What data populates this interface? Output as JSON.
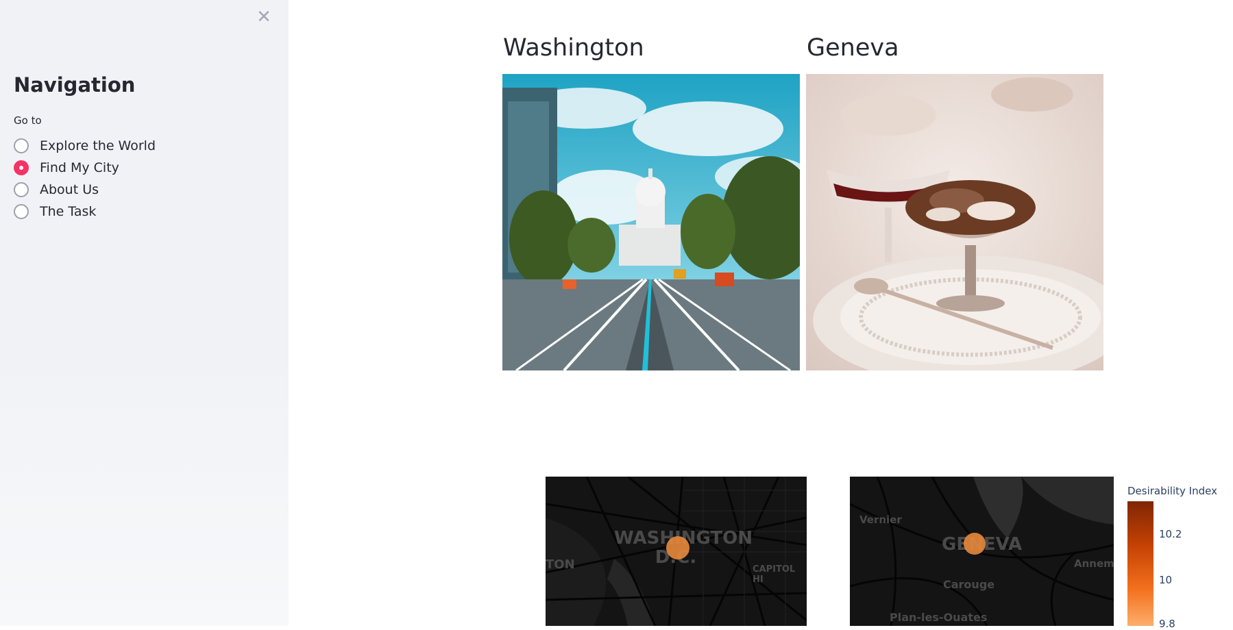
{
  "sidebar": {
    "close_icon": "close-icon",
    "title": "Navigation",
    "goto_label": "Go to",
    "options": [
      {
        "label": "Explore the World",
        "selected": false
      },
      {
        "label": "Find My City",
        "selected": true
      },
      {
        "label": "About Us",
        "selected": false
      },
      {
        "label": "The Task",
        "selected": false
      }
    ]
  },
  "cities": [
    {
      "name": "Washington",
      "map_label": "WASHINGTON D.C.",
      "map_sublabels": [
        "TON",
        "CAPITOL HI"
      ]
    },
    {
      "name": "Geneva",
      "map_label": "GENEVA",
      "map_sublabels": [
        "Vernier",
        "Carouge",
        "Plan-les-Ouates",
        "Annem"
      ]
    }
  ],
  "colorbar": {
    "title": "Desirability Index",
    "ticks": [
      "10.2",
      "10",
      "9.8"
    ],
    "colors": [
      "#7f2704",
      "#c44103",
      "#f2701d",
      "#fdae6b"
    ],
    "marker_color": "#e88a3c"
  },
  "colors": {
    "accent": "#f63366",
    "sidebar_bg": "#f0f2f6",
    "map_bg": "#141414"
  }
}
